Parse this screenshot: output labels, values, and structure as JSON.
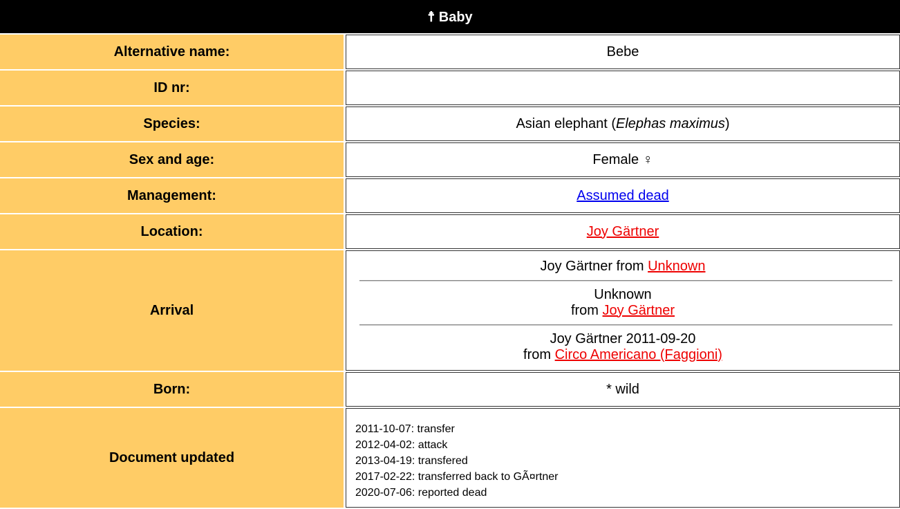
{
  "header": {
    "title": "☨ Baby"
  },
  "rows": {
    "alt_name": {
      "label": "Alternative name:",
      "value": "Bebe"
    },
    "id_nr": {
      "label": "ID nr:",
      "value": ""
    },
    "species": {
      "label": "Species:",
      "common": "Asian elephant",
      "open": " (",
      "latin": "Elephas maximus",
      "close": ")"
    },
    "sex_age": {
      "label": "Sex and age:",
      "value": "Female ♀"
    },
    "management": {
      "label": "Management:",
      "link": "Assumed dead"
    },
    "location": {
      "label": "Location:",
      "link": "Joy Gärtner"
    },
    "arrival": {
      "label": "Arrival",
      "entries": [
        {
          "line1": "Joy Gärtner from ",
          "line2": "",
          "link": "Unknown"
        },
        {
          "line1": "Unknown",
          "line2": "from ",
          "link": "Joy Gärtner"
        },
        {
          "line1": "Joy Gärtner 2011-09-20",
          "line2": "from ",
          "link": "Circo Americano (Faggioni)"
        }
      ]
    },
    "born": {
      "label": "Born:",
      "value": "* wild"
    },
    "updated": {
      "label": "Document updated",
      "lines": [
        "2011-10-07: transfer",
        "2012-04-02: attack",
        "2013-04-19: transfered",
        "2017-02-22: transferred back to GÃ¤rtner",
        "2020-07-06: reported dead"
      ]
    }
  },
  "colors": {
    "label_bg": "#ffcc66",
    "header_bg": "#000000",
    "link_blue": "#0000ee",
    "link_red": "#ee0000"
  }
}
